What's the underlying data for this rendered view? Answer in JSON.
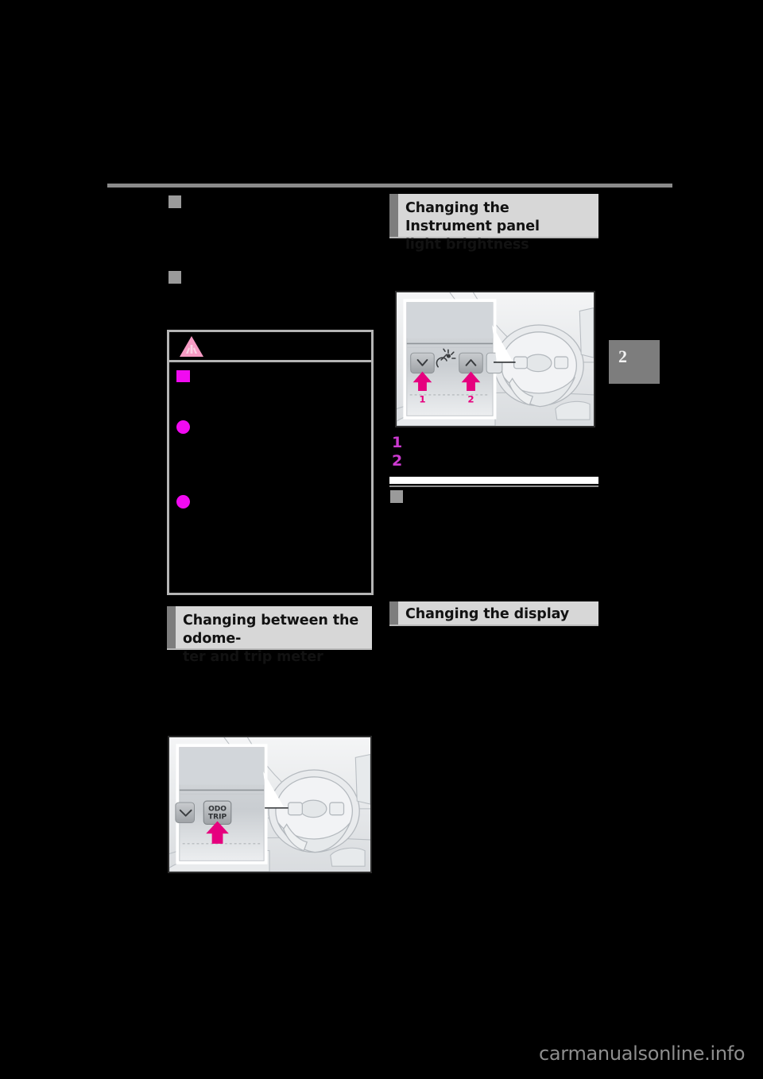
{
  "page": {
    "background_color": "#000000",
    "rule_color": "#8a8a8a",
    "accent_magenta": "#e6007e",
    "chapter_tab": {
      "number": "2",
      "color": "#7d7d7d"
    }
  },
  "left_column": {
    "section_markers": [
      {
        "name": "redacted-subsection-1"
      },
      {
        "name": "redacted-subsection-2"
      }
    ],
    "warning_box": {
      "icon": "warning-triangle-icon",
      "bullets": [
        {
          "type": "square",
          "color": "#f10af1"
        },
        {
          "type": "round",
          "color": "#f10af1"
        },
        {
          "type": "round",
          "color": "#f10af1"
        }
      ]
    },
    "heading": {
      "line1": "Changing between the odome-",
      "line2": "ter and trip meter"
    },
    "illustration": {
      "name": "odo-trip-button-illustration",
      "button_label_line1": "ODO",
      "button_label_line2": "TRIP",
      "callout_arrow": "magenta-up-arrow"
    }
  },
  "right_column": {
    "heading": {
      "line1": "Changing the Instrument panel",
      "line2": "light brightness"
    },
    "illustration": {
      "name": "instrument-panel-brightness-illustration",
      "callouts": [
        {
          "number": "1",
          "icon": "chevron-down-icon"
        },
        {
          "number": "2",
          "icon": "chevron-up-icon"
        }
      ],
      "center_icon": "dimmer-lamp-icon"
    },
    "steps": [
      {
        "number": "1"
      },
      {
        "number": "2"
      }
    ],
    "subsection_marker": {
      "name": "redacted-subsection-3"
    },
    "heading2": {
      "line1": "Changing the display"
    }
  },
  "watermark": {
    "text": "carmanualsonline.info"
  }
}
